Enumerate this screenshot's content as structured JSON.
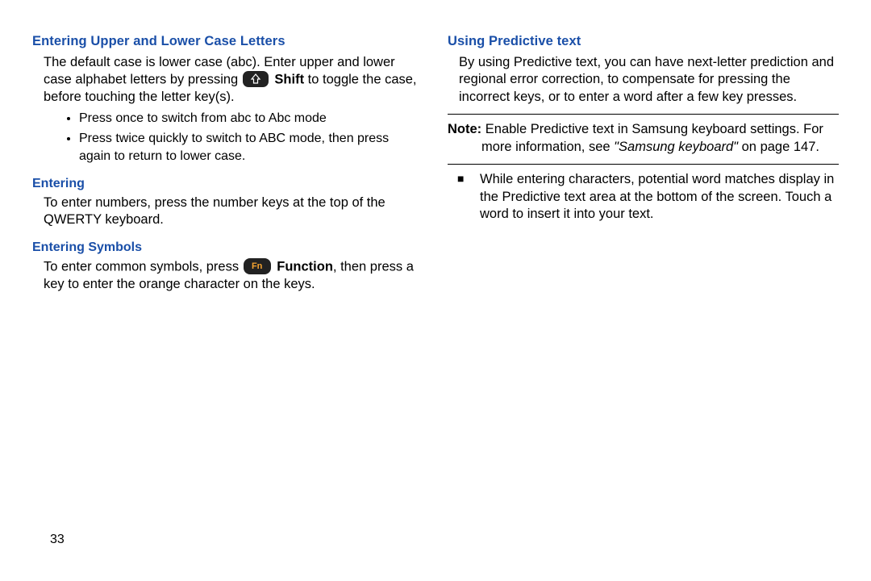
{
  "left": {
    "h1": "Entering Upper and Lower Case Letters",
    "p1a": "The default case is lower case (abc). Enter upper and lower case alphabet letters by pressing ",
    "shift_label": "Shift",
    "p1b": " to toggle the case, before touching the letter key(s).",
    "b1": "Press once to switch from abc to Abc mode",
    "b2": "Press twice quickly to switch to ABC mode, then press again to return to lower case.",
    "h2": "Entering",
    "p2": "To enter numbers, press the number keys at the top of the QWERTY keyboard.",
    "h3": "Entering Symbols",
    "p3a": "To enter common symbols, press ",
    "fn_label": "Function",
    "fn_key": "Fn",
    "p3b": ", then press a key to enter the orange character on the keys."
  },
  "right": {
    "h1": "Using Predictive text",
    "p1": "By using Predictive text, you can have next-letter prediction and regional error correction, to compensate for pressing the incorrect keys, or to enter a word after a few key presses.",
    "note_label": "Note:",
    "note_a": " Enable Predictive text in Samsung keyboard settings. For more information, see ",
    "note_ref": "\"Samsung keyboard\"",
    "note_b": " on page 147.",
    "sq1": "While entering characters, potential word matches display in the Predictive text area at the bottom of the screen. Touch a word to insert it into your text."
  },
  "page_number": "33"
}
